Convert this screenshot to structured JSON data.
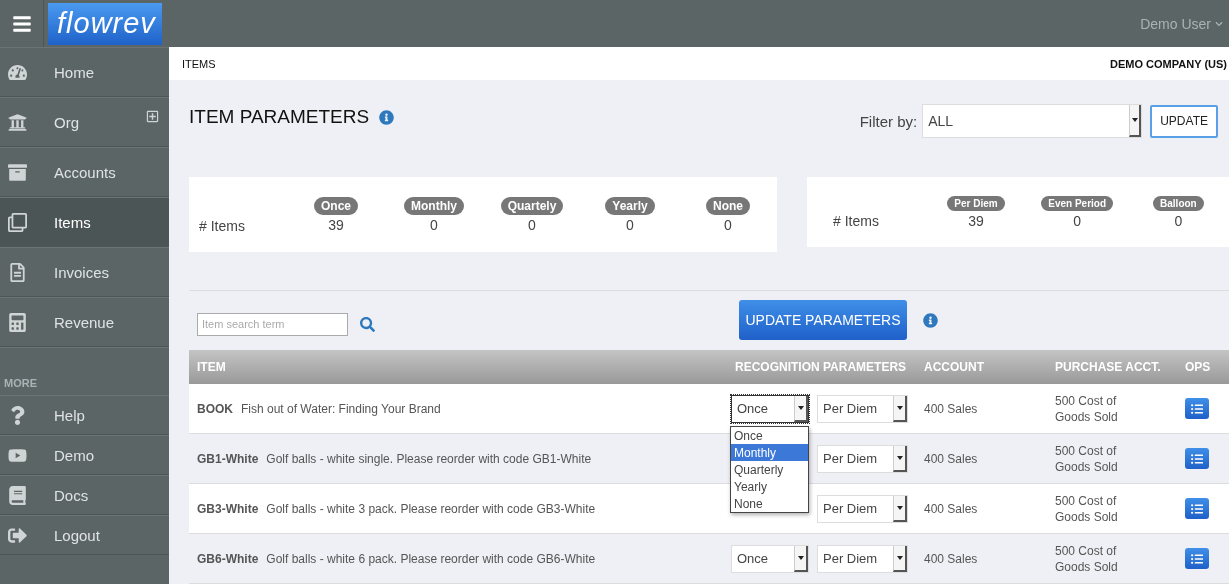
{
  "app": {
    "logo": "flowrev",
    "user": "Demo User"
  },
  "sidebar": {
    "items": [
      {
        "label": "Home",
        "selected": false,
        "expandable": false
      },
      {
        "label": "Org",
        "selected": false,
        "expandable": true
      },
      {
        "label": "Accounts",
        "selected": false,
        "expandable": false
      },
      {
        "label": "Items",
        "selected": true,
        "expandable": false
      },
      {
        "label": "Invoices",
        "selected": false,
        "expandable": false
      },
      {
        "label": "Revenue",
        "selected": false,
        "expandable": false
      }
    ],
    "section_label": "MORE",
    "more_items": [
      {
        "label": "Help"
      },
      {
        "label": "Demo"
      },
      {
        "label": "Docs"
      },
      {
        "label": "Logout"
      }
    ]
  },
  "breadcrumb": "ITEMS",
  "company": "DEMO COMPANY (US)",
  "title": "ITEM PARAMETERS",
  "filter": {
    "label": "Filter by:",
    "value": "ALL"
  },
  "update_button": "UPDATE",
  "stats": [
    {
      "row_label": "# Items",
      "columns": [
        {
          "badge": "Once",
          "count": "39"
        },
        {
          "badge": "Monthly",
          "count": "0"
        },
        {
          "badge": "Quartely",
          "count": "0"
        },
        {
          "badge": "Yearly",
          "count": "0"
        },
        {
          "badge": "None",
          "count": "0"
        }
      ]
    },
    {
      "row_label": "# Items",
      "columns": [
        {
          "badge": "Per Diem",
          "count": "39"
        },
        {
          "badge": "Even Period",
          "count": "0"
        },
        {
          "badge": "Balloon",
          "count": "0"
        }
      ]
    }
  ],
  "search": {
    "placeholder": "Item search term"
  },
  "update_parameters_button": "UPDATE PARAMETERS",
  "table": {
    "columns": [
      "ITEM",
      "RECOGNITION PARAMETERS",
      "ACCOUNT",
      "PURCHASE ACCT.",
      "OPS"
    ],
    "rows": [
      {
        "code": "BOOK",
        "description": "Fish out of Water: Finding Your Brand",
        "recognition": "Once",
        "focused": true,
        "schedule": "Per Diem",
        "account": "400 Sales",
        "purchase_account": "500 Cost of Goods Sold"
      },
      {
        "code": "GB1-White",
        "description": "Golf balls - white single. Please reorder with code GB1-White",
        "schedule": "Per Diem",
        "account": "400 Sales",
        "purchase_account": "500 Cost of Goods Sold"
      },
      {
        "code": "GB3-White",
        "description": "Golf balls - white 3 pack. Please reorder with code GB3-White",
        "schedule": "Per Diem",
        "account": "400 Sales",
        "purchase_account": "500 Cost of Goods Sold"
      },
      {
        "code": "GB6-White",
        "description": "Golf balls - white 6 pack. Please reorder with code GB6-White",
        "recognition": "Once",
        "focused": false,
        "schedule": "Per Diem",
        "account": "400 Sales",
        "purchase_account": "500 Cost of Goods Sold"
      }
    ]
  },
  "dropdown": {
    "options": [
      {
        "label": "Once",
        "selected": false
      },
      {
        "label": "Monthly",
        "selected": true
      },
      {
        "label": "Quarterly",
        "selected": false
      },
      {
        "label": "Yearly",
        "selected": false
      },
      {
        "label": "None",
        "selected": false
      }
    ]
  }
}
